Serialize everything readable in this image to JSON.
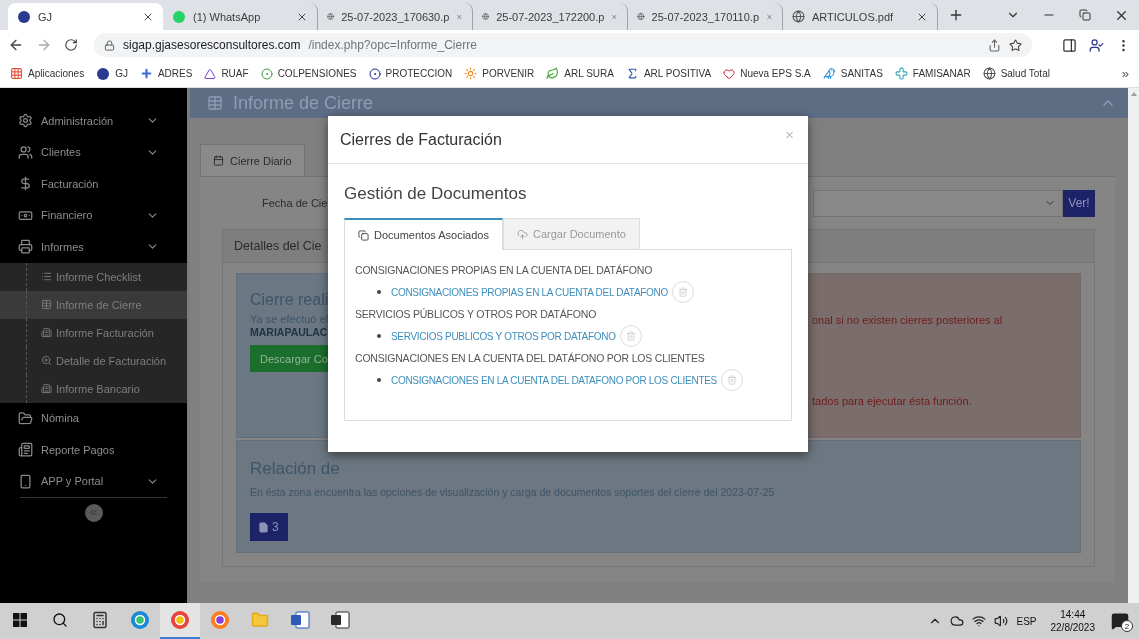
{
  "browser": {
    "tabs": [
      {
        "title": "GJ",
        "selected": true
      },
      {
        "title": "(1) WhatsApp",
        "selected": false
      },
      {
        "title": "25-07-2023_170630.p",
        "selected": false
      },
      {
        "title": "25-07-2023_172200.p",
        "selected": false
      },
      {
        "title": "25-07-2023_170110.p",
        "selected": false
      },
      {
        "title": "ARTICULOS.pdf",
        "selected": false
      }
    ],
    "url": {
      "host": "sigap.gjasesoresconsultores.com",
      "path": "/index.php?opc=Informe_Cierre"
    },
    "bookmarks": [
      "Aplicaciones",
      "GJ",
      "ADRES",
      "RUAF",
      "COLPENSIONES",
      "PROTECCION",
      "PORVENIR",
      "ARL SURA",
      "ARL POSITIVA",
      "Nueva EPS S.A",
      "SANITAS",
      "FAMISANAR",
      "Salud Total"
    ],
    "more": "»"
  },
  "sidebar": {
    "items": [
      {
        "label": "Administración",
        "kind": "group"
      },
      {
        "label": "Clientes",
        "kind": "group"
      },
      {
        "label": "Facturación",
        "kind": "link"
      },
      {
        "label": "Financiero",
        "kind": "group"
      },
      {
        "label": "Informes",
        "kind": "group",
        "children": [
          {
            "label": "Informe Checklist",
            "selected": false
          },
          {
            "label": "Informe de Cierre",
            "selected": true
          },
          {
            "label": "Informe Facturación",
            "selected": false
          },
          {
            "label": "Detalle de Facturación",
            "selected": false
          },
          {
            "label": "Informe Bancario",
            "selected": false
          }
        ]
      },
      {
        "label": "Nómina",
        "kind": "link"
      },
      {
        "label": "Reporte Pagos",
        "kind": "link"
      },
      {
        "label": "APP y Portal",
        "kind": "group"
      }
    ]
  },
  "page": {
    "title": "Informe de Cierre",
    "tabs": [
      {
        "label": "Cierre Diario",
        "selected": true
      }
    ],
    "date_label": "Fecha de Cie",
    "view_button": "Ver!",
    "details_title": "Detalles del Cie",
    "closure": {
      "heading": "Cierre reali",
      "text": "Ya se efectuó el",
      "user": "MARIAPAULAC",
      "download": "Descargar Co",
      "note_1": "onal si no existen cierres posteriores al",
      "note_2": "tados para ejecutar ésta función."
    },
    "supports": {
      "title": "Relación de",
      "text": "En ésta zona encuentra las opciones de visualización y carga de documentos soportes del cierre del 2023-07-25",
      "count": "3"
    }
  },
  "modal": {
    "title": "Cierres de Facturación",
    "close": "×",
    "subtitle": "Gestión de Documentos",
    "tabs": [
      {
        "label": "Documentos Asociados",
        "selected": true
      },
      {
        "label": "Cargar Documento",
        "selected": false
      }
    ],
    "sections": [
      {
        "heading": "CONSIGNACIONES PROPIAS EN LA CUENTA DEL DATÁFONO",
        "document": "CONSIGNACIONES PROPIAS EN LA CUENTA DEL DATAFONO"
      },
      {
        "heading": "SERVICIOS PÚBLICOS Y OTROS POR DATÁFONO",
        "document": "SERVICIOS PUBLICOS Y OTROS POR DATAFONO"
      },
      {
        "heading": "CONSIGNACIONES EN LA CUENTA DEL DATÁFONO POR LOS CLIENTES",
        "document": "CONSIGNACIONES EN LA CUENTA DEL DATAFONO POR LOS CLIENTES"
      }
    ]
  },
  "taskbar": {
    "apps": [
      {
        "selected": false
      },
      {
        "selected": false
      },
      {
        "selected": true
      },
      {
        "selected": false
      },
      {
        "selected": false
      },
      {
        "selected": false
      },
      {
        "selected": false
      }
    ],
    "language": "ESP",
    "time": "14:44",
    "date": "22/8/2023",
    "notifications": "2"
  }
}
